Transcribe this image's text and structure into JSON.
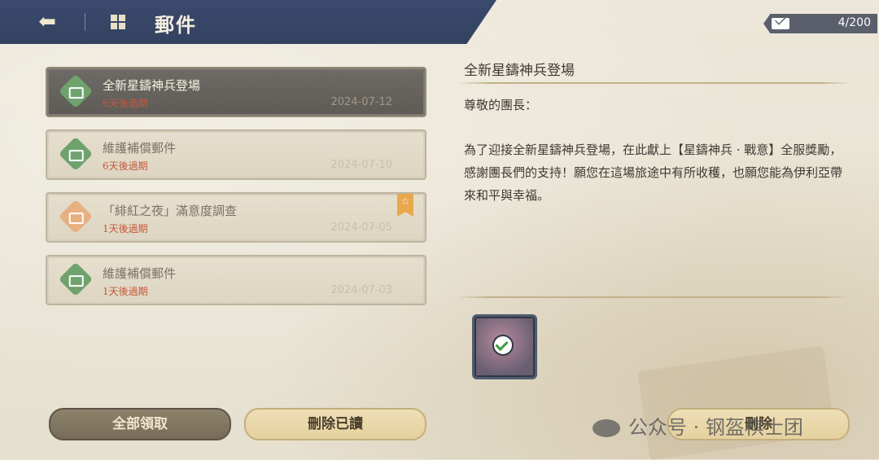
{
  "header": {
    "title": "郵件",
    "counter": "4/200"
  },
  "mails": [
    {
      "subject": "全新星鑄神兵登場",
      "expiry": "6天後過期",
      "date": "2024-07-12",
      "icon": "green",
      "selected": true
    },
    {
      "subject": "維護補償郵件",
      "expiry": "6天後過期",
      "date": "2024-07-10",
      "icon": "green",
      "selected": false
    },
    {
      "subject": "「緋紅之夜」滿意度調查",
      "expiry": "1天後過期",
      "date": "2024-07-05",
      "icon": "orange",
      "selected": false,
      "starred": true
    },
    {
      "subject": "維護補償郵件",
      "expiry": "1天後過期",
      "date": "2024-07-03",
      "icon": "green",
      "selected": false
    }
  ],
  "detail": {
    "title": "全新星鑄神兵登場",
    "greeting": "尊敬的團長：",
    "body": "為了迎接全新星鑄神兵登場，在此獻上【星鑄神兵 · 戰意】全服獎勵，感謝團長們的支持！願您在這場旅途中有所收穫，也願您能為伊利亞帶來和平與幸福。"
  },
  "buttons": {
    "claim_all": "全部領取",
    "delete_read": "刪除已讀",
    "delete": "刪除"
  },
  "watermark": "公众号 · 钢盔棋士团"
}
